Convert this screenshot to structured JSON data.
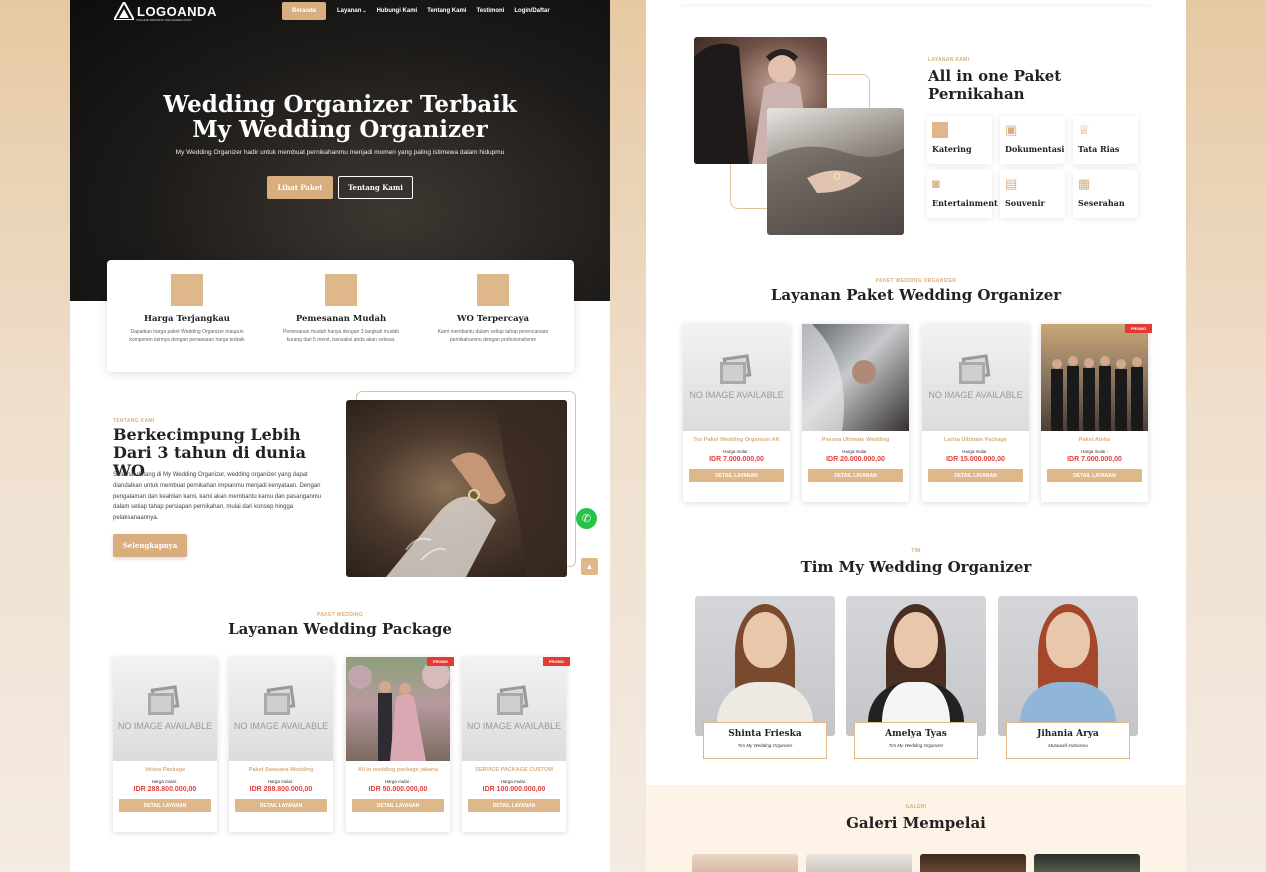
{
  "header": {
    "logo_text": "LOGOANDA",
    "logo_tagline": "TAGLINE WEDDING ORGANIZER ANDA",
    "nav": [
      "Beranda",
      "Layanan",
      "Hubungi Kami",
      "Tentang Kami",
      "Testimoni",
      "Login/Daftar"
    ],
    "nav_caret": "⌄"
  },
  "hero": {
    "title_line1": "Wedding Organizer Terbaik",
    "title_line2": "My Wedding Organizer",
    "subtitle": "My Wedding Organizer hadir untuk membuat pernikahanmu menjadi momen yang paling istimewa dalam hidupmu",
    "primary_button": "Lihat Paket",
    "secondary_button": "Tentang Kami"
  },
  "features": [
    {
      "title": "Harga Terjangkau",
      "desc": "Dapatkan harga paket Wedding Organizer maupun komponen lainnya dengan penawaran harga terbaik"
    },
    {
      "title": "Pemesanan Mudah",
      "desc": "Pemesanan mudah hanya dengan 3 langkah mudah kurang dari 5 menit, transaksi anda akan selesai."
    },
    {
      "title": "WO Terpercaya",
      "desc": "Kami membantu dalam setiap tahap perencanaan pernikahanmu dengan profesionalisme"
    }
  ],
  "about": {
    "eyebrow": "TENTANG KAMI",
    "title": "Berkecimpung Lebih Dari 3 tahun di dunia WO",
    "text": "Selamat datang di My Wedding Organizer, wedding organizer yang dapat diandalkan untuk membuat pernikahan impianmu menjadi kenyataan. Dengan pengalaman dan keahlian kami, kami akan membantu kamu dan pasanganmu dalam setiap tahap persiapan pernikahan, mulai dari konsep hingga pelaksanaannya.",
    "button": "Selengkapnya"
  },
  "packages_left": {
    "eyebrow": "PAKET WEDDING",
    "title": "Layanan Wedding Package",
    "items": [
      {
        "name": "Velora Package",
        "price_label": "Harga mulai :",
        "price": "IDR 288.800.000,00",
        "button": "DETAIL LAYANAN",
        "promo": "",
        "noimg": "NO IMAGE AVAILABLE"
      },
      {
        "name": "Paket Swasana Wedding",
        "price_label": "Harga mulai :",
        "price": "IDR 288.800.000,00",
        "button": "DETAIL LAYANAN",
        "promo": "",
        "noimg": "NO IMAGE AVAILABLE"
      },
      {
        "name": "All in wedding package jakarta",
        "price_label": "Harga mulai :",
        "price": "IDR 50.000.000,00",
        "button": "DETAIL LAYANAN",
        "promo": "PROMO",
        "noimg": ""
      },
      {
        "name": "SERVICE PACKAGE CUSTOM",
        "price_label": "Harga mulai :",
        "price": "IDR 100.000.000,00",
        "button": "DETAIL LAYANAN",
        "promo": "PROMO",
        "noimg": "NO IMAGE AVAILABLE"
      }
    ]
  },
  "services": {
    "eyebrow": "LAYANAN KAMI",
    "title_line1": "All in one Paket",
    "title_line2": "Pernikahan",
    "items": [
      {
        "name": "Katering",
        "icon": "catering-icon"
      },
      {
        "name": "Dokumentasi",
        "icon": "photo-icon"
      },
      {
        "name": "Tata Rias",
        "icon": "makeup-icon"
      },
      {
        "name": "Entertainment",
        "icon": "camera-icon"
      },
      {
        "name": "Souvenir",
        "icon": "bag-icon"
      },
      {
        "name": "Seserahan",
        "icon": "gift-icon"
      }
    ]
  },
  "packages_right": {
    "eyebrow": "PAKET WEDDING ORGANIZER",
    "title": "Layanan Paket Wedding Organizer",
    "items": [
      {
        "name": "Tes Paket Wedding Organizer AK",
        "price_label": "Harga mulai :",
        "price": "IDR 7.000.000,00",
        "button": "DETAIL LAYANAN",
        "promo": "",
        "noimg": "NO IMAGE AVAILABLE"
      },
      {
        "name": "Pesona Ultimate Wedding",
        "price_label": "Harga mulai :",
        "price": "IDR 20.000.000,00",
        "button": "DETAIL LAYANAN",
        "promo": "",
        "noimg": ""
      },
      {
        "name": "Lariza Ultimate Package",
        "price_label": "Harga mulai :",
        "price": "IDR 15.000.000,00",
        "button": "DETAIL LAYANAN",
        "promo": "",
        "noimg": "NO IMAGE AVAILABLE"
      },
      {
        "name": "Paket Aloha",
        "price_label": "Harga mulai :",
        "price": "IDR 7.000.000,00",
        "button": "DETAIL LAYANAN",
        "promo": "PROMO",
        "noimg": ""
      }
    ]
  },
  "team": {
    "eyebrow": "TIM",
    "title": "Tim My Wedding Organizer",
    "members": [
      {
        "name": "Shinta Frieska",
        "role": "Tim My Wedding Organizer"
      },
      {
        "name": "Amelya Tyas",
        "role": "Tim My Wedding Organizer"
      },
      {
        "name": "Jihania Arya",
        "role": "Mutawwif Indonesia"
      }
    ]
  },
  "gallery": {
    "eyebrow": "GALERI",
    "title": "Galeri Mempelai"
  },
  "colors": {
    "accent": "#d8ae7e",
    "price": "#e24040",
    "promo": "#e53935",
    "whatsapp": "#27c24a"
  }
}
